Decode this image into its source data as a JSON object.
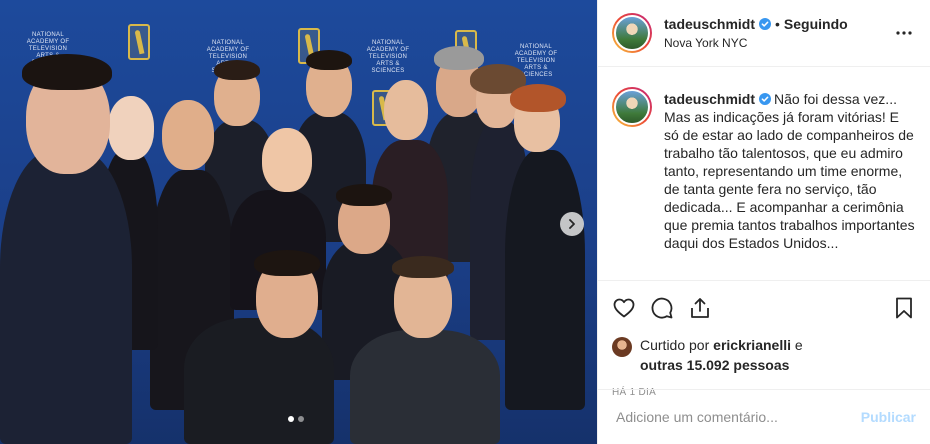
{
  "post": {
    "username": "tadeuschmidt",
    "verified": true,
    "follow_status": "Seguindo",
    "location": "Nova York NYC",
    "caption": "Não foi dessa vez... Mas as indicações já foram vitórias! E só de estar ao lado de companheiros de trabalho tão talentosos, que eu admiro tanto, representando um time enorme, de tanta gente fera no serviço, tão dedicada... E acompanhar a cerimônia que premia tantos trabalhos importantes daqui dos Estados Unidos...",
    "likes": {
      "prefix": "Curtido por",
      "user": "erickrianelli",
      "connector": "e",
      "others": "outras 15.092 pessoas"
    },
    "time": "HÁ 1 DIA"
  },
  "photo": {
    "backdrop_text": "NATIONAL ACADEMY OF TELEVISION ARTS & SCIENCES",
    "carousel_count": 2,
    "carousel_active": 1
  },
  "comment": {
    "placeholder": "Adicione um comentário...",
    "publish_label": "Publicar"
  },
  "icons": {
    "verified": "verified-badge-icon",
    "more": "more-options-icon",
    "like": "heart-icon",
    "comment": "comment-icon",
    "share": "share-icon",
    "save": "bookmark-icon",
    "next": "chevron-right-icon"
  },
  "colors": {
    "verified_blue": "#3897f0",
    "publish_disabled": "#b3dbff",
    "backdrop_blue": "#1d4a9c"
  }
}
